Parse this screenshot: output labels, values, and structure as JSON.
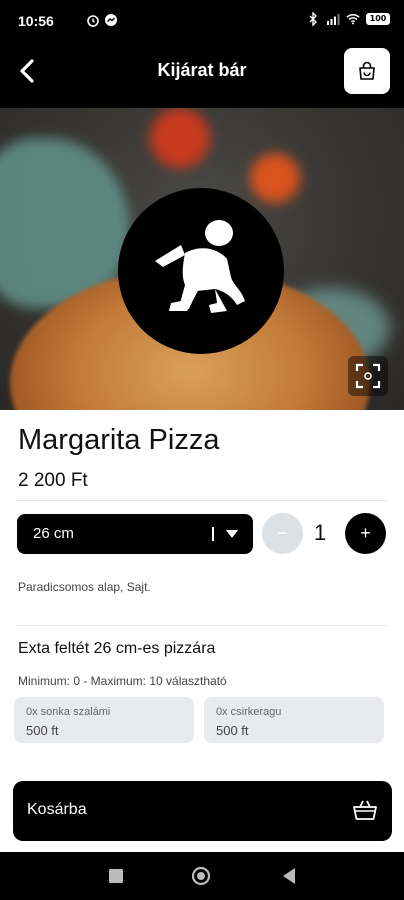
{
  "status_bar": {
    "time": "10:56",
    "battery": "100",
    "icons": [
      "alarm-icon",
      "messenger-icon",
      "bluetooth-icon",
      "signal-icon",
      "wifi-icon",
      "battery-icon"
    ]
  },
  "header": {
    "title": "Kijárat bár",
    "back_icon": "chevron-left-icon",
    "cart_icon": "shopping-bag-icon"
  },
  "product": {
    "name": "Margarita Pizza",
    "price": "2 200 Ft",
    "ingredients": "Paradicsomos alap, Sajt."
  },
  "size_select": {
    "value": "26 cm"
  },
  "quantity": {
    "value": "1",
    "minus_label": "−",
    "plus_label": "+"
  },
  "extras": {
    "title": "Exta feltét 26 cm-es pizzára",
    "limits": "Minimum: 0 - Maximum: 10 választható",
    "options": [
      {
        "name": "0x sonka szalámi",
        "price": "500 ft"
      },
      {
        "name": "0x csirkeragu",
        "price": "500 ft"
      }
    ]
  },
  "add_to_cart": {
    "label": "Kosárba",
    "icon": "basket-icon"
  },
  "colors": {
    "primary": "#000000",
    "background": "#ffffff",
    "option_bg": "#e8eaed",
    "minus_bg": "#dde1e4"
  }
}
